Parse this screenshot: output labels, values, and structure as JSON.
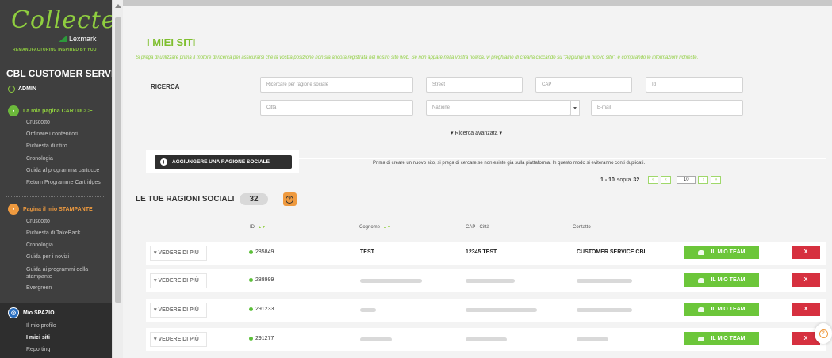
{
  "brand": {
    "logo_script": "Collected",
    "logo_sub": "Lexmark",
    "tagline": "REMANUFACTURING INSPIRED BY YOU"
  },
  "sidebar": {
    "title": "CBL CUSTOMER SERVICE",
    "user": "ADMIN",
    "section_cartucce": {
      "label": "La mia pagina CARTUCCE",
      "items": [
        "Cruscotto",
        "Ordinare i contenitori",
        "Richiesta di ritiro",
        "Cronologia",
        "Guida al programma cartucce",
        "Return Programme Cartridges"
      ]
    },
    "section_stampante": {
      "label": "Pagina il mio STAMPANTE",
      "items": [
        "Cruscotto",
        "Richiesta di TakeBack",
        "Cronologia",
        "Guida per i novizi",
        "Guida ai programmi della stampante",
        "Evergreen"
      ]
    },
    "section_spazio": {
      "label": "Mio SPAZIO",
      "items": [
        "Il mio profilo",
        "I miei siti",
        "Reporting"
      ]
    }
  },
  "main": {
    "title": "I MIEI SITI",
    "intro": "Si prega di utilizzare prima il motore di ricerca per assicurarsi che la vostra posizione non sia ancora registrata nel nostro sito web. Se non appare nella vostra ricerca, vi preghiamo di crearla cliccando su \"Aggiungi un nuovo sito\", e compilando le informazioni richieste.",
    "search_label": "RICERCA",
    "search": {
      "ragione_sociale": "Ricercare per ragione sociale",
      "street": "Street",
      "cap": "CAP",
      "id": "Id",
      "citta": "Città",
      "nazione": "Nazione",
      "email": "E-mail"
    },
    "advanced": "▾ Ricerca avanzata ▾",
    "add_button": "AGGIUNGERE UNA RAGIONE SOCIALE",
    "add_hint": "Prima di creare un nuovo sito, si prega di cercare se non esiste già sulla piattaforma. In questo modo si eviteranno conti duplicati.",
    "pager": {
      "range": "1 - 10",
      "sopra": "sopra",
      "total": "32",
      "page_size": "10"
    },
    "section_title": "LE TUE RAGIONI SOCIALI",
    "count": "32",
    "columns": {
      "id": "ID",
      "cognome": "Cognome",
      "cap": "CAP - Città",
      "contatto": "Contatto"
    },
    "sort_glyph": "▲▼",
    "vedere": "▾ VEDERE DI PIÙ",
    "team_label": "IL MIO TEAM",
    "delete_label": "X",
    "rows": [
      {
        "id": "285849",
        "cognome": "TEST",
        "cap": "12345 TEST",
        "contatto": "CUSTOMER SERVICE CBL"
      },
      {
        "id": "288999",
        "cognome": "",
        "cap": "",
        "contatto": ""
      },
      {
        "id": "291233",
        "cognome": "",
        "cap": "",
        "contatto": ""
      },
      {
        "id": "291277",
        "cognome": "",
        "cap": "",
        "contatto": ""
      }
    ]
  },
  "colors": {
    "accent_green": "#7fbf2f",
    "team_green": "#6cc63a",
    "delete_red": "#d6303f",
    "orange": "#ef9a3f",
    "sidebar": "#3f3f3f"
  }
}
